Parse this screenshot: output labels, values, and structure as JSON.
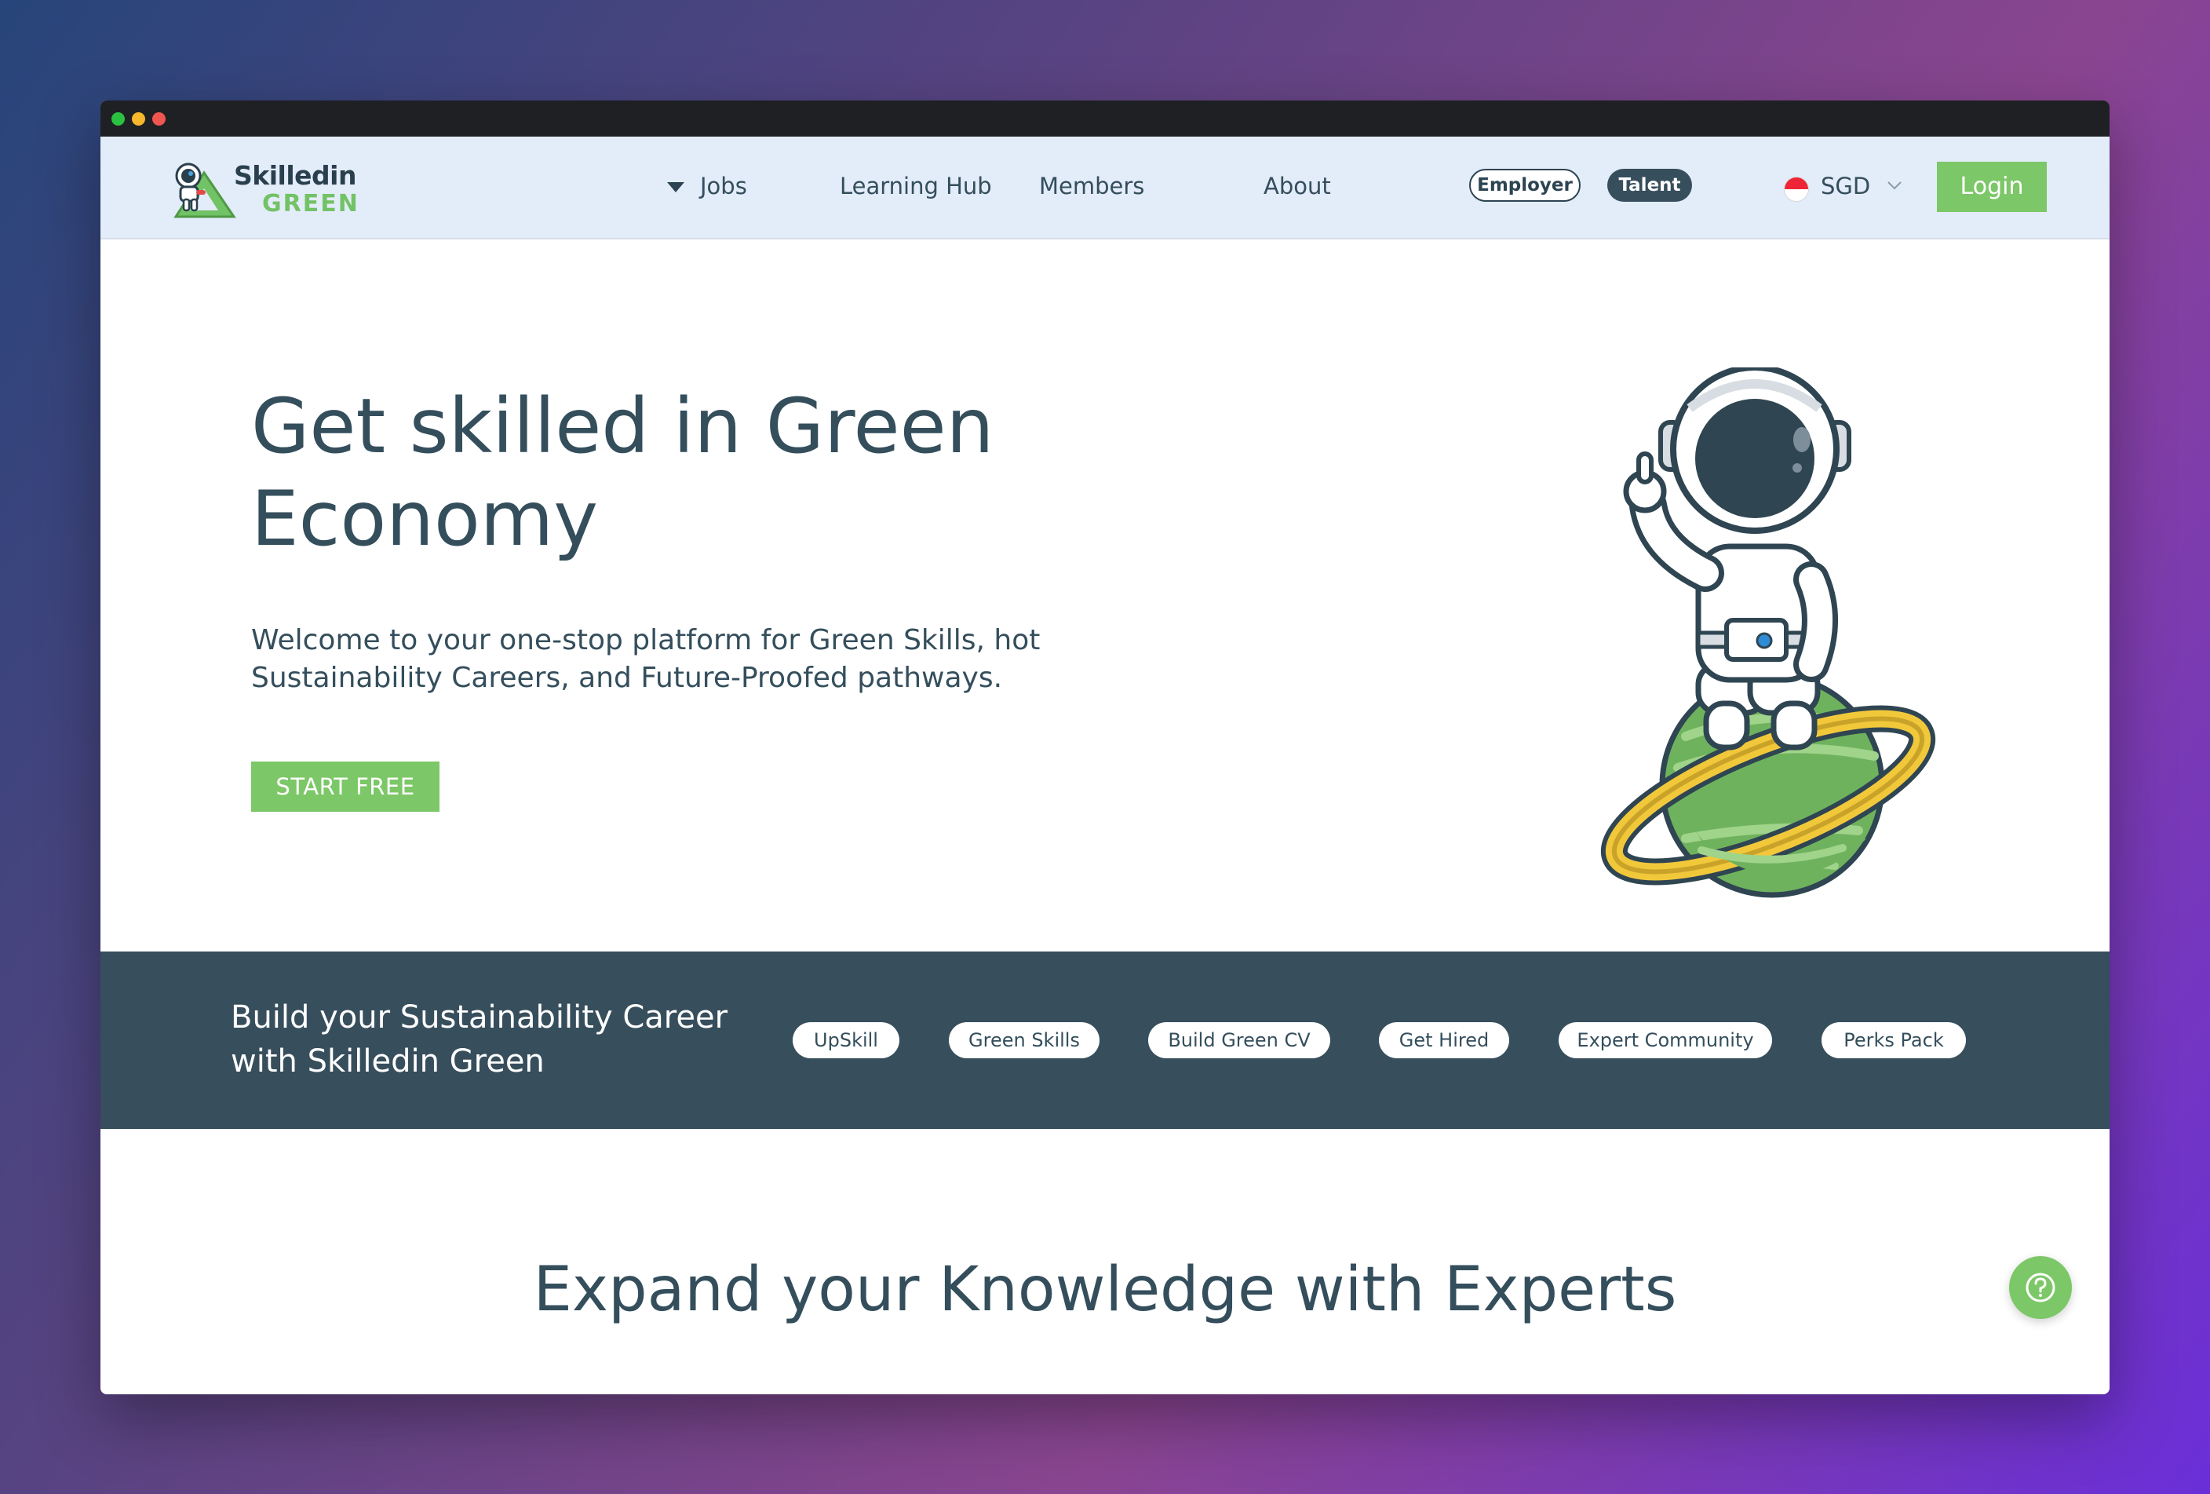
{
  "browser": {
    "controls": [
      "close",
      "minimize",
      "maximize"
    ]
  },
  "brand": {
    "name_top": "Skilledin",
    "name_bottom": "GREEN",
    "icon": "astronaut-logo-icon"
  },
  "nav": {
    "items": [
      {
        "label": "Jobs",
        "icon": "caret-down-icon"
      },
      {
        "label": "Learning Hub"
      },
      {
        "label": "Members"
      },
      {
        "label": "About"
      }
    ],
    "audience": {
      "employer": "Employer",
      "talent": "Talent",
      "active": "Talent"
    },
    "currency": {
      "flag": "singapore-flag-icon",
      "code": "SGD",
      "icon": "chevron-down-icon"
    },
    "login": "Login"
  },
  "hero": {
    "title": "Get skilled in Green Economy",
    "description": "Welcome to your one-stop platform for Green Skills, hot Sustainability Careers, and Future-Proofed pathways.",
    "cta": "START FREE",
    "illustration": "astronaut-on-planet-illustration"
  },
  "band": {
    "text": "Build your Sustainability Career with Skilledin Green",
    "tags": [
      "UpSkill",
      "Green Skills",
      "Build Green CV",
      "Get Hired",
      "Expert Community",
      "Perks Pack"
    ]
  },
  "section": {
    "title": "Expand your Knowledge with Experts"
  },
  "help": {
    "icon": "help-question-icon"
  },
  "colors": {
    "primary_green": "#7cc767",
    "dark_slate": "#374e5c",
    "nav_bg": "#e3ecf9"
  }
}
